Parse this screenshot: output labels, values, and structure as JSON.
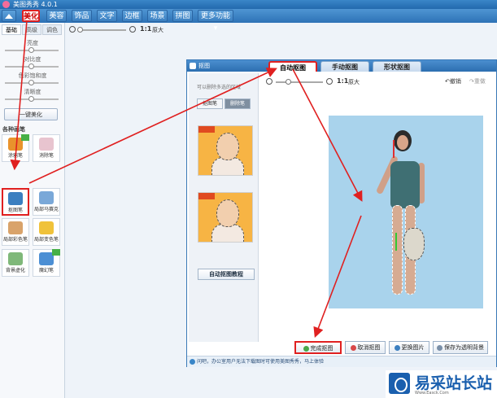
{
  "app": {
    "title": "美图秀秀 4.0.1"
  },
  "menu": {
    "items": [
      {
        "label": "美化",
        "active": true
      },
      {
        "label": "美容"
      },
      {
        "label": "饰品"
      },
      {
        "label": "文字"
      },
      {
        "label": "边框"
      },
      {
        "label": "场景"
      },
      {
        "label": "拼图"
      },
      {
        "label": "更多功能 ▾"
      }
    ]
  },
  "left": {
    "tabs": [
      {
        "label": "基础"
      },
      {
        "label": "高级"
      },
      {
        "label": "调色"
      }
    ],
    "sliders": [
      {
        "label": "亮度"
      },
      {
        "label": "对比度"
      },
      {
        "label": "色彩饱和度"
      },
      {
        "label": "清晰度"
      }
    ],
    "one_key": "一键美化",
    "section": "各种画笔",
    "tools": [
      {
        "label": "涂鸦笔",
        "color": "#e9932c"
      },
      {
        "label": "消除笔",
        "color": "#e8c4cf"
      },
      {
        "label": "抠图笔",
        "color": "#3b7fc0",
        "selected": true
      },
      {
        "label": "局部马赛克",
        "color": "#7aa8d8"
      },
      {
        "label": "局部彩色笔",
        "color": "#d9a36a"
      },
      {
        "label": "局部变色笔",
        "color": "#f0c23a"
      },
      {
        "label": "背景虚化",
        "color": "#7fb879"
      },
      {
        "label": "魔幻笔",
        "color": "#4c8fd4"
      }
    ]
  },
  "toolbar": {
    "ratio": "1:1",
    "original": "原大"
  },
  "dialog": {
    "title": "抠图",
    "tabs": [
      {
        "label": "自动抠图",
        "active": true
      },
      {
        "label": "手动抠图"
      },
      {
        "label": "形状抠图"
      }
    ],
    "hint": "可以删除多选的区域",
    "segments": [
      {
        "label": "抠图笔"
      },
      {
        "label": "删除笔",
        "active": true
      }
    ],
    "tutorial": "自动抠图教程",
    "zoom_ratio": "1:1",
    "zoom_original": "原大",
    "undo": "撤销",
    "redo": "重做",
    "buttons": [
      {
        "label": "完成抠图",
        "color": "#4aa84a",
        "highlight": true
      },
      {
        "label": "取消抠图",
        "color": "#d94848"
      },
      {
        "label": "更换图片",
        "color": "#3b7fc0"
      },
      {
        "label": "保存为透明背景",
        "color": "#7a8fa8"
      }
    ],
    "status": "问吧，办公室用户无法下载图时可使用美图秀秀，马上体验"
  },
  "brand": {
    "name": "易采站长站",
    "url": "Www.Easck.Com"
  },
  "colors": {
    "accent": "#2d72b6",
    "highlight": "#e02020"
  }
}
